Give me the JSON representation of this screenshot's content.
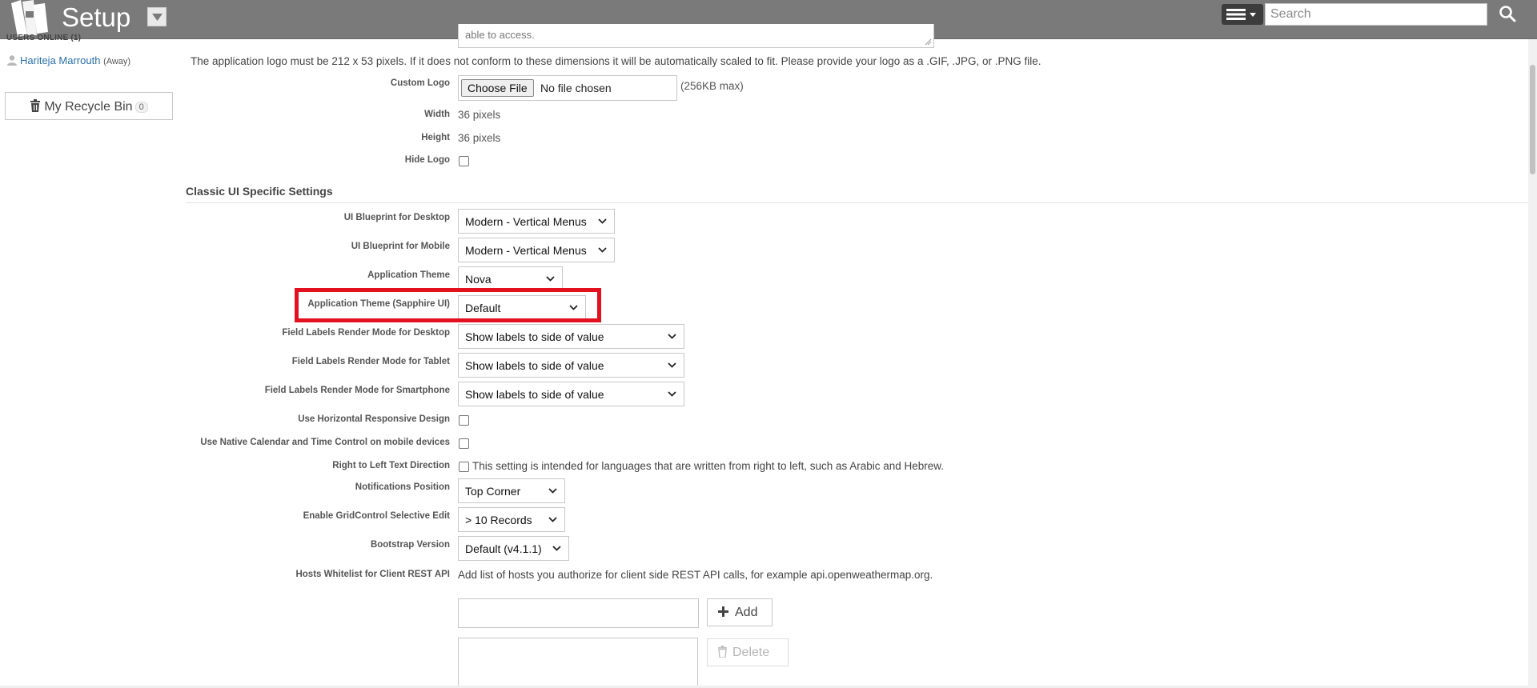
{
  "header": {
    "title": "Setup",
    "search_placeholder": "Search",
    "logo_icon": "app-logo-icon",
    "menu_icon": "hamburger-menu-icon",
    "search_icon": "magnifier-icon",
    "background_color": "#7a7a7a"
  },
  "sidebar": {
    "users_online_label": "USERS ONLINE (1)",
    "user_name": "Hariteja Marrouth",
    "user_status": "(Away)",
    "recycle_bin_label": "My Recycle Bin",
    "recycle_bin_count": "0"
  },
  "logo_section": {
    "partial_text": "able to access.",
    "note": "The application logo must be 212 x 53 pixels. If it does not conform to these dimensions it will be automatically scaled to fit. Please provide your logo as a .GIF, .JPG, or .PNG file.",
    "custom_logo_label": "Custom Logo",
    "choose_file_label": "Choose File",
    "no_file_text": "No file chosen",
    "max_size": "(256KB max)",
    "width_label": "Width",
    "width_value": "36 pixels",
    "height_label": "Height",
    "height_value": "36 pixels",
    "hide_logo_label": "Hide Logo",
    "hide_logo_checked": false
  },
  "classic_ui": {
    "section_title": "Classic UI Specific Settings",
    "blueprint_desktop_label": "UI Blueprint for Desktop",
    "blueprint_desktop_value": "Modern - Vertical Menus",
    "blueprint_mobile_label": "UI Blueprint for Mobile",
    "blueprint_mobile_value": "Modern - Vertical Menus",
    "app_theme_label": "Application Theme",
    "app_theme_value": "Nova",
    "sapphire_theme_label": "Application Theme (Sapphire UI)",
    "sapphire_theme_value": "Default",
    "field_labels_desktop_label": "Field Labels Render Mode for Desktop",
    "field_labels_desktop_value": "Show labels to side of value",
    "field_labels_tablet_label": "Field Labels Render Mode for Tablet",
    "field_labels_tablet_value": "Show labels to side of value",
    "field_labels_smartphone_label": "Field Labels Render Mode for Smartphone",
    "field_labels_smartphone_value": "Show labels to side of value",
    "horizontal_responsive_label": "Use Horizontal Responsive Design",
    "native_calendar_label": "Use Native Calendar and Time Control on mobile devices",
    "rtl_label": "Right to Left Text Direction",
    "rtl_text": "This setting is intended for languages that are written from right to left, such as Arabic and Hebrew.",
    "notifications_label": "Notifications Position",
    "notifications_value": "Top Corner",
    "gridcontrol_label": "Enable GridControl Selective Edit",
    "gridcontrol_value": "> 10 Records",
    "bootstrap_label": "Bootstrap Version",
    "bootstrap_value": "Default (v4.1.1)",
    "hosts_label": "Hosts Whitelist for Client REST API",
    "hosts_help": "Add list of hosts you authorize for client side REST API calls, for example api.openweathermap.org.",
    "add_label": "Add",
    "delete_label": "Delete",
    "highlight_color": "#e3101f"
  }
}
